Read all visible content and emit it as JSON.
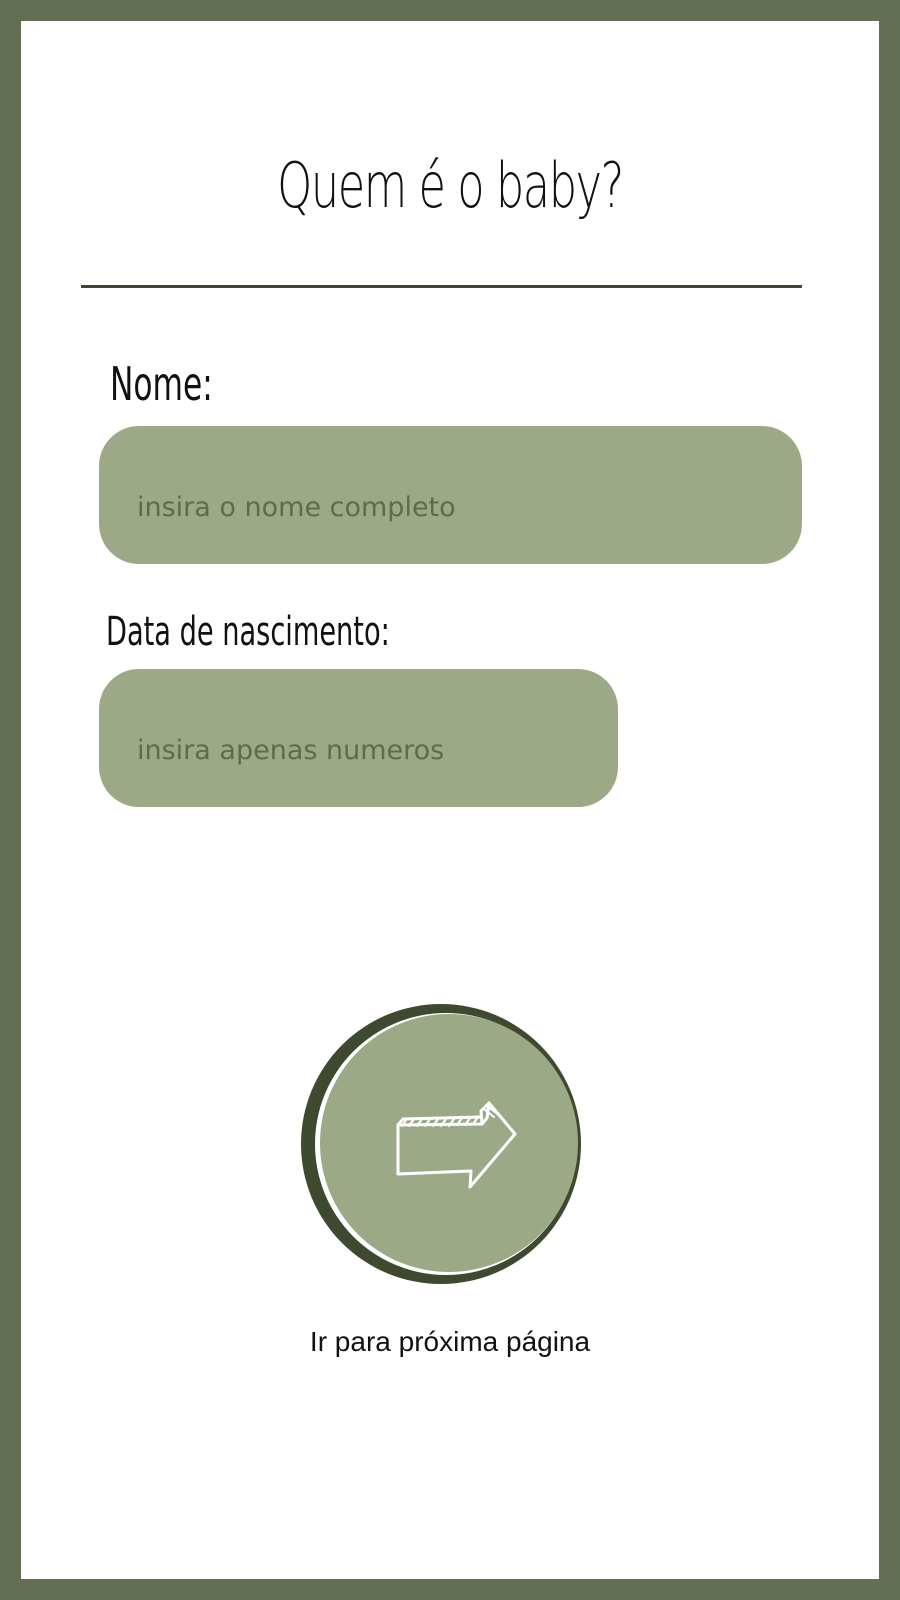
{
  "page": {
    "title": "Quem é o baby?",
    "frame_color": "#626f53",
    "accent_color": "#9ca987",
    "dark_accent": "#3e4a30"
  },
  "form": {
    "name": {
      "label": "Nome:",
      "placeholder": "insira o nome completo"
    },
    "birthdate": {
      "label": "Data de nascimento:",
      "placeholder": "insira apenas numeros"
    }
  },
  "next": {
    "icon": "arrow-right-icon",
    "caption": "Ir para próxima página"
  }
}
